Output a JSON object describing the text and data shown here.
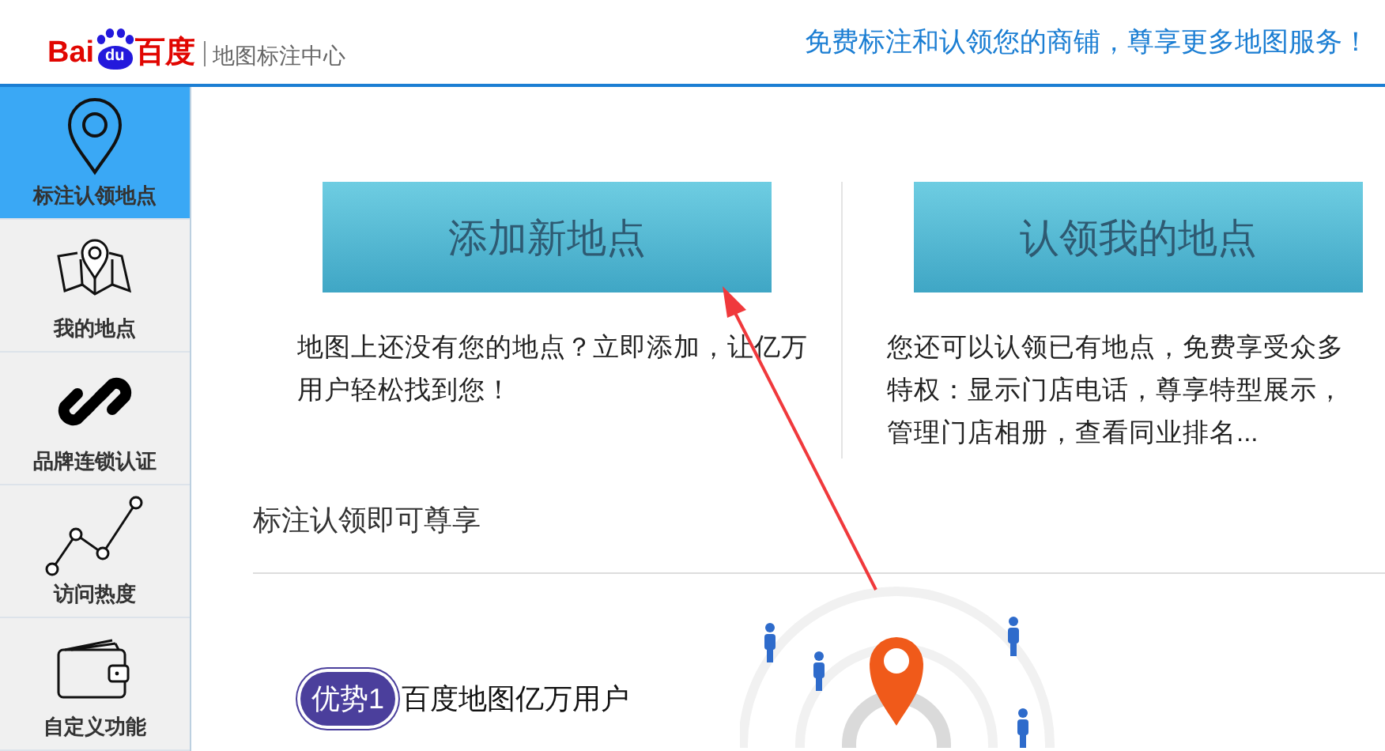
{
  "header": {
    "logo": {
      "left": "Bai",
      "middle": "du",
      "right": "百度"
    },
    "section_title": "地图标注中心",
    "tagline": "免费标注和认领您的商铺，尊享更多地图服务！"
  },
  "sidebar": {
    "items": [
      {
        "label": "标注认领地点",
        "kind": "pin",
        "selected": true
      },
      {
        "label": "我的地点",
        "kind": "map",
        "selected": false
      },
      {
        "label": "品牌连锁认证",
        "kind": "link",
        "selected": false
      },
      {
        "label": "访问热度",
        "kind": "chart",
        "selected": false
      },
      {
        "label": "自定义功能",
        "kind": "wallet",
        "selected": false
      }
    ]
  },
  "actions": [
    {
      "button": "添加新地点",
      "description": "地图上还没有您的地点？立即添加，让亿万用户轻松找到您！"
    },
    {
      "button": "认领我的地点",
      "description": "您还可以认领已有地点，免费享受众多特权：显示门店电话，尊享特型展示，管理门店相册，查看同业排名..."
    }
  ],
  "benefits": {
    "title": "标注认领即可尊享",
    "items": [
      {
        "badge": "优势1",
        "text": "百度地图亿万用户"
      }
    ]
  }
}
